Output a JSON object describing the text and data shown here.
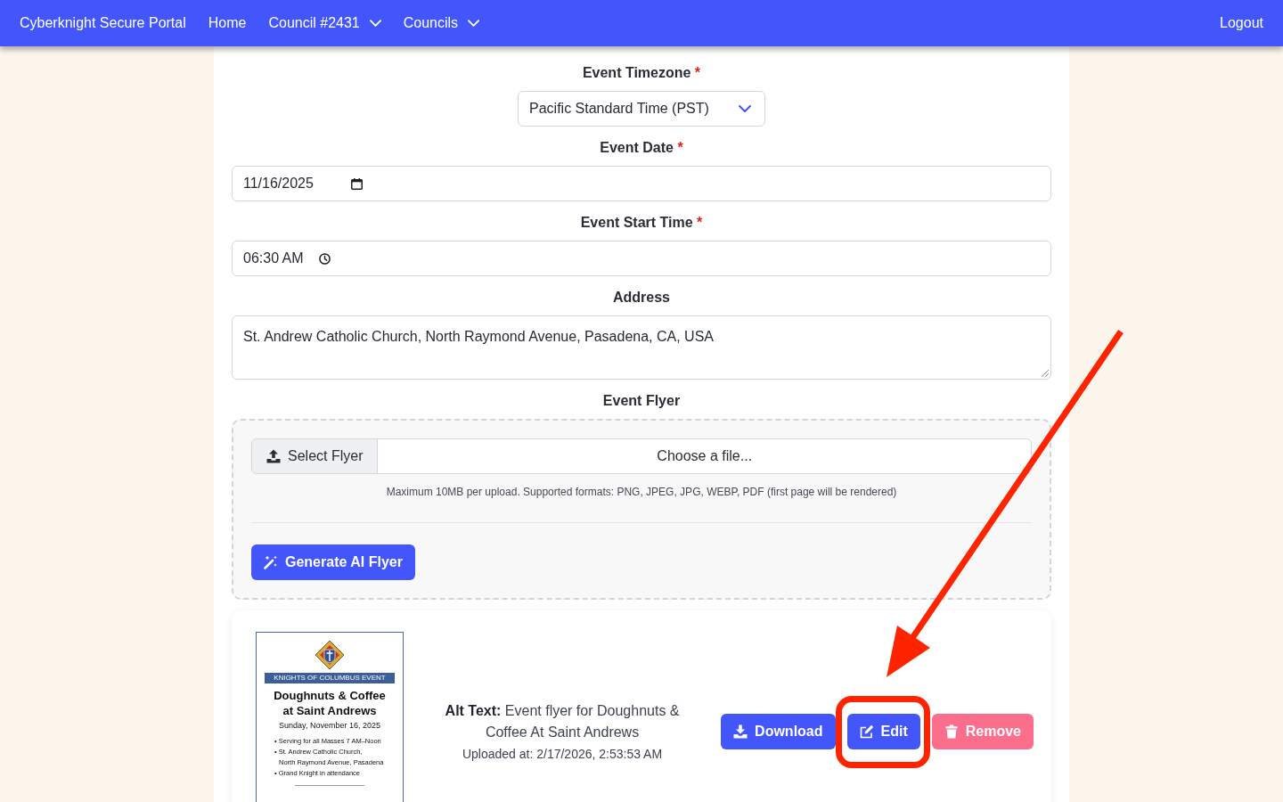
{
  "navbar": {
    "brand": "Cyberknight Secure Portal",
    "links": [
      {
        "label": "Home",
        "dropdown": false
      },
      {
        "label": "Council #2431",
        "dropdown": true
      },
      {
        "label": "Councils",
        "dropdown": true
      }
    ],
    "logout": "Logout"
  },
  "form": {
    "fields": [
      {
        "kind": "select",
        "label": "Event Timezone",
        "required_mark": "*",
        "value": "Pacific Standard Time (PST)"
      },
      {
        "kind": "date",
        "label": "Event Date",
        "required_mark": "*",
        "value": "11/16/2025"
      },
      {
        "kind": "time",
        "label": "Event Start Time",
        "required_mark": "*",
        "value": "06:30 AM"
      },
      {
        "kind": "textarea",
        "label": "Address",
        "value": "St. Andrew Catholic Church, North Raymond Avenue, Pasadena, CA, USA"
      }
    ]
  },
  "flyer": {
    "label": "Event Flyer",
    "select_button": "Select Flyer",
    "placeholder": "Choose a file...",
    "help": "Maximum 10MB per upload. Supported formats: PNG, JPEG, JPG, WEBP, PDF (first page will be rendered)",
    "generate_button": "Generate AI Flyer"
  },
  "preview": {
    "thumbnail": {
      "banner": "KNIGHTS OF COLUMBUS EVENT",
      "title": "Doughnuts & Coffee\nat Saint Andrews",
      "date": "Sunday, November 16, 2025",
      "bullets": [
        "• Serving for all Masses 7 AM–Noon",
        "• St. Andrew Catholic Church,\nNorth Raymond Avenue, Pasadena",
        "• Grand Knight in attendance"
      ]
    },
    "alt_text": "**Alt Text:** Event flyer for Doughnuts & Coffee At Saint Andrews",
    "uploaded": "Uploaded at: 2/17/2026, 2:53:53 AM",
    "buttons": [
      {
        "kind": "download",
        "label": "Download",
        "circled": false
      },
      {
        "kind": "edit",
        "label": "Edit",
        "circled": true
      },
      {
        "kind": "remove",
        "label": "Remove",
        "circled": false
      }
    ]
  },
  "annotation_arrow": true
}
